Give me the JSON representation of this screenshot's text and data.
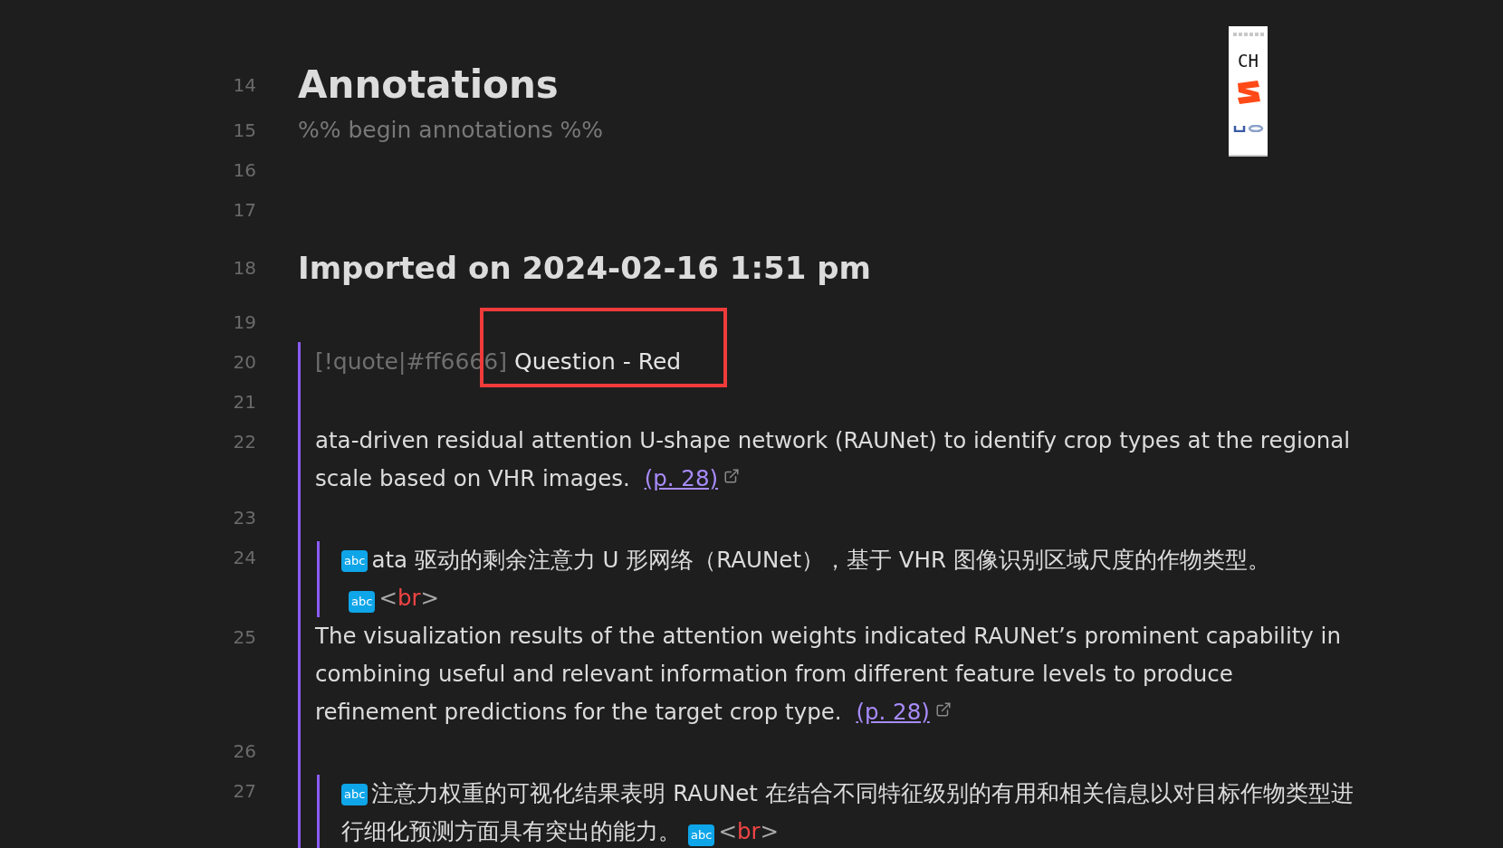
{
  "lines": [
    {
      "number": "14",
      "kind": "heading1",
      "text": "Annotations"
    },
    {
      "number": "15",
      "kind": "comment",
      "text": "%% begin annotations %%"
    },
    {
      "number": "16",
      "kind": "blank"
    },
    {
      "number": "17",
      "kind": "blank"
    },
    {
      "number": "18",
      "kind": "heading2",
      "text": "Imported on 2024-02-16 1:51 pm"
    },
    {
      "number": "19",
      "kind": "blank"
    }
  ],
  "quote": {
    "number": "20",
    "marker": "[!quote|#ff6666]",
    "title": "Question - Red",
    "lines": [
      {
        "number": "21",
        "kind": "blank"
      },
      {
        "number": "22",
        "kind": "text",
        "text": "ata-driven residual attention U-shape network (RAUNet) to identify crop types at the regional scale based on VHR images.",
        "link": "(p. 28)"
      },
      {
        "number": "23",
        "kind": "blank"
      },
      {
        "number": "24",
        "kind": "translation",
        "badge": "abc",
        "text": "ata 驱动的剩余注意力 U 形网络（RAUNet），基于 VHR 图像识别区域尺度的作物类型。",
        "tag": {
          "badge": "abc",
          "open": "<",
          "name": "br",
          "close": ">"
        }
      },
      {
        "number": "25",
        "kind": "text",
        "text": "The visualization results of the attention weights indicated RAUNet’s prominent capability in combining useful and relevant information from different feature levels to produce refinement predictions for the target crop type.",
        "link": "(p. 28)"
      },
      {
        "number": "26",
        "kind": "blank"
      },
      {
        "number": "27",
        "kind": "translation",
        "badge": "abc",
        "text": "注意力权重的可视化结果表明 RAUNet 在结合不同特征级别的有用和相关信息以对目标作物类型进行细化预测方面具有突出的能力。",
        "tag": {
          "badge": "abc",
          "open": "<",
          "name": "br",
          "close": ">"
        }
      }
    ]
  },
  "ime_toolbar": {
    "language": "CH"
  }
}
